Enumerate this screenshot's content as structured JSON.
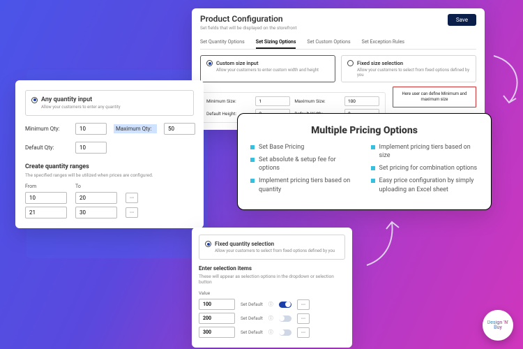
{
  "config": {
    "title": "Product Configuration",
    "sub": "Set fields that will be displayed on the storefront",
    "save": "Save",
    "tabs": [
      "Set Quantity Options",
      "Set Sizing Options",
      "Set Custom Options",
      "Set Exception Rules"
    ],
    "activeTab": 1,
    "opt1": {
      "title": "Custom size input",
      "desc": "Allow your customers to enter custom width and height"
    },
    "opt2": {
      "title": "Fixed size selection",
      "desc": "Allow your customers to select from fixed options defined by you"
    },
    "fields": {
      "minLabel": "Minimum Size:",
      "minVal": "1",
      "maxLabel": "Maximum Size:",
      "maxVal": "100",
      "dhLabel": "Default Height:",
      "dhVal": "2",
      "dwLabel": "Default Width:",
      "dwVal": "2"
    },
    "callout": "Here user can define Minimum and maximum size"
  },
  "pricing": {
    "title": "Multiple Pricing Options",
    "left": [
      "Set Base Pricing",
      "Set absolute & setup fee for options",
      "Implement pricing tiers based on quantity"
    ],
    "right": [
      "Implement pricing tiers based on size",
      "Set pricing for combination options",
      "Easy price configuration by simply uploading an Excel sheet"
    ]
  },
  "qty": {
    "opt": {
      "title": "Any quantity input",
      "desc": "Allow your customers to enter any quantity"
    },
    "minL": "Minimum Qty:",
    "minV": "10",
    "maxL": "Maximum Qty:",
    "maxV": "50",
    "defL": "Default Qty:",
    "defV": "10",
    "rangeTitle": "Create quantity ranges",
    "rangeHint": "The specified ranges will be utilized when prices are configured.",
    "fromL": "From",
    "toL": "To",
    "rows": [
      {
        "f": "10",
        "t": "20"
      },
      {
        "f": "21",
        "t": "30"
      }
    ]
  },
  "fqty": {
    "opt": {
      "title": "Fixed quantity selection",
      "desc": "Allow your customers to select from fixed options defined by you"
    },
    "sec": "Enter selection items",
    "hint": "These will appear as selection options in the dropdown or selection button",
    "valL": "Value",
    "setL": "Set Default",
    "rows": [
      {
        "v": "100",
        "on": true
      },
      {
        "v": "200",
        "on": false
      },
      {
        "v": "300",
        "on": false
      }
    ]
  },
  "badge": "Design 'N' Buy"
}
